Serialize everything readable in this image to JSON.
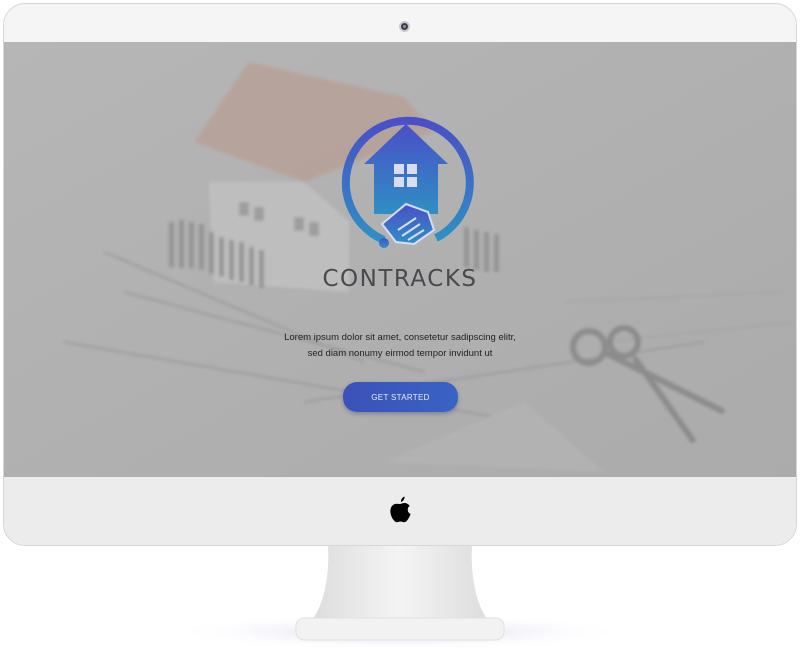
{
  "hero": {
    "brand_name": "CONTRACKS",
    "tagline_line1": "Lorem ipsum dolor sit amet, consetetur sadipscing elitr,",
    "tagline_line2": "sed diam nonumy eirmod tempor invidunt ut",
    "cta_label": "GET STARTED"
  },
  "logo": {
    "icon": "house-handshake-icon",
    "gradient_top": "#4a4fc7",
    "gradient_bottom": "#2f8fc4"
  },
  "device": {
    "camera_icon": "camera-icon",
    "brand_icon": "apple-logo-icon"
  },
  "colors": {
    "button": "#3b55bb",
    "brand_text": "#4a4a4e",
    "bezel": "#f5f5f6"
  }
}
